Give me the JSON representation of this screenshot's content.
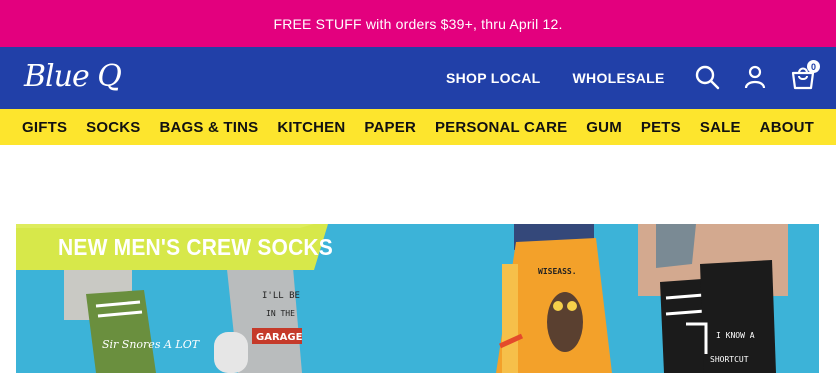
{
  "promo": {
    "text": "FREE STUFF with orders $39+, thru April 12."
  },
  "header": {
    "logo_text": "Blue Q",
    "nav": [
      {
        "label": "SHOP LOCAL"
      },
      {
        "label": "WHOLESALE"
      }
    ],
    "icons": [
      "search-icon",
      "account-icon",
      "cart-icon"
    ],
    "cart_count": "0"
  },
  "categories": [
    {
      "label": "GIFTS"
    },
    {
      "label": "SOCKS"
    },
    {
      "label": "BAGS & TINS"
    },
    {
      "label": "KITCHEN"
    },
    {
      "label": "PAPER"
    },
    {
      "label": "PERSONAL CARE"
    },
    {
      "label": "GUM"
    },
    {
      "label": "PETS"
    },
    {
      "label": "SALE"
    },
    {
      "label": "ABOUT"
    }
  ],
  "hero": {
    "title": "NEW MEN'S CREW SOCKS",
    "sock_texts": {
      "sock1": "Sir Snores A LOT",
      "sock2_top": "I'LL BE",
      "sock2_mid": "IN THE",
      "sock2_bottom": "GARAGE",
      "sock3": "WISEASS.",
      "sock4_line1": "I KNOW A",
      "sock4_line2": "SHORTCUT"
    }
  },
  "colors": {
    "promo_bg": "#e3007e",
    "header_bg": "#2140a8",
    "category_bg": "#fde52d",
    "hero_bg": "#3cb3d8",
    "banner_bg": "#d7e84a"
  }
}
